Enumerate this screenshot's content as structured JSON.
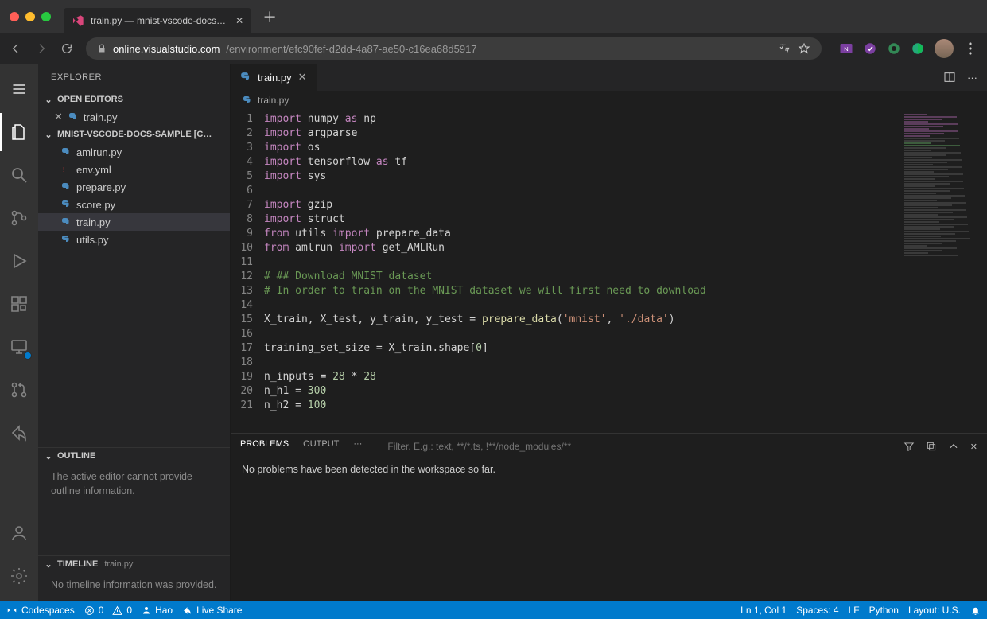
{
  "window": {
    "tab_title": "train.py — mnist-vscode-docs…"
  },
  "url": {
    "domain": "online.visualstudio.com",
    "path": "/environment/efc90fef-d2dd-4a87-ae50-c16ea68d5917"
  },
  "sidebar": {
    "title": "EXPLORER",
    "open_editors_label": "OPEN EDITORS",
    "open_editors": [
      "train.py"
    ],
    "folder_label": "MNIST-VSCODE-DOCS-SAMPLE [C…",
    "files": [
      "amlrun.py",
      "env.yml",
      "prepare.py",
      "score.py",
      "train.py",
      "utils.py"
    ],
    "outline_label": "OUTLINE",
    "outline_msg": "The active editor cannot provide outline information.",
    "timeline_label": "TIMELINE",
    "timeline_suffix": "train.py",
    "timeline_msg": "No timeline information was provided."
  },
  "editor": {
    "tab_label": "train.py",
    "breadcrumb": "train.py"
  },
  "code": {
    "lines": [
      [
        [
          "kw",
          "import"
        ],
        [
          "id",
          " numpy "
        ],
        [
          "kw",
          "as"
        ],
        [
          "id",
          " np"
        ]
      ],
      [
        [
          "kw",
          "import"
        ],
        [
          "id",
          " argparse"
        ]
      ],
      [
        [
          "kw",
          "import"
        ],
        [
          "id",
          " os"
        ]
      ],
      [
        [
          "kw",
          "import"
        ],
        [
          "id",
          " tensorflow "
        ],
        [
          "kw",
          "as"
        ],
        [
          "id",
          " tf"
        ]
      ],
      [
        [
          "kw",
          "import"
        ],
        [
          "id",
          " sys"
        ]
      ],
      [
        [
          "id",
          ""
        ]
      ],
      [
        [
          "kw",
          "import"
        ],
        [
          "id",
          " gzip"
        ]
      ],
      [
        [
          "kw",
          "import"
        ],
        [
          "id",
          " struct"
        ]
      ],
      [
        [
          "kw",
          "from"
        ],
        [
          "id",
          " utils "
        ],
        [
          "kw",
          "import"
        ],
        [
          "id",
          " prepare_data"
        ]
      ],
      [
        [
          "kw",
          "from"
        ],
        [
          "id",
          " amlrun "
        ],
        [
          "kw",
          "import"
        ],
        [
          "id",
          " get_AMLRun"
        ]
      ],
      [
        [
          "id",
          ""
        ]
      ],
      [
        [
          "cm",
          "# ## Download MNIST dataset"
        ]
      ],
      [
        [
          "cm",
          "# In order to train on the MNIST dataset we will first need to download"
        ]
      ],
      [
        [
          "id",
          ""
        ]
      ],
      [
        [
          "id",
          "X_train, X_test, y_train, y_test = "
        ],
        [
          "fn",
          "prepare_data"
        ],
        [
          "id",
          "("
        ],
        [
          "str",
          "'mnist'"
        ],
        [
          "id",
          ", "
        ],
        [
          "str",
          "'./data'"
        ],
        [
          "id",
          ")"
        ]
      ],
      [
        [
          "id",
          ""
        ]
      ],
      [
        [
          "id",
          "training_set_size = X_train.shape["
        ],
        [
          "num",
          "0"
        ],
        [
          "id",
          "]"
        ]
      ],
      [
        [
          "id",
          ""
        ]
      ],
      [
        [
          "id",
          "n_inputs = "
        ],
        [
          "num",
          "28"
        ],
        [
          "id",
          " * "
        ],
        [
          "num",
          "28"
        ]
      ],
      [
        [
          "id",
          "n_h1 = "
        ],
        [
          "num",
          "300"
        ]
      ],
      [
        [
          "id",
          "n_h2 = "
        ],
        [
          "num",
          "100"
        ]
      ]
    ]
  },
  "panel": {
    "tabs": {
      "problems": "PROBLEMS",
      "output": "OUTPUT",
      "more": "···"
    },
    "filter_placeholder": "Filter. E.g.: text, **/*.ts, !**/node_modules/**",
    "message": "No problems have been detected in the workspace so far."
  },
  "status": {
    "codespaces": "Codespaces",
    "errors": "0",
    "warnings": "0",
    "user": "Hao",
    "liveshare": "Live Share",
    "ln_col": "Ln 1, Col 1",
    "spaces": "Spaces: 4",
    "eol": "LF",
    "lang": "Python",
    "layout": "Layout: U.S.",
    "bell": "◕"
  }
}
